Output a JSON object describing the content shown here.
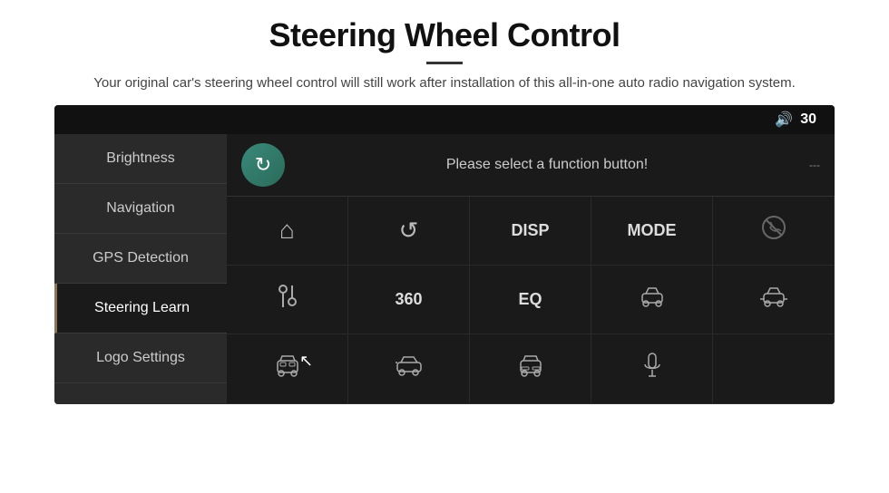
{
  "header": {
    "title": "Steering Wheel Control",
    "description": "Your original car's steering wheel control will still work after installation of this all-in-one auto radio navigation system."
  },
  "device": {
    "volume_icon": "🔊",
    "volume_level": "30",
    "sidebar": {
      "items": [
        {
          "id": "brightness",
          "label": "Brightness",
          "active": false
        },
        {
          "id": "navigation",
          "label": "Navigation",
          "active": false
        },
        {
          "id": "gps-detection",
          "label": "GPS Detection",
          "active": false
        },
        {
          "id": "steering-learn",
          "label": "Steering Learn",
          "active": true
        },
        {
          "id": "logo-settings",
          "label": "Logo Settings",
          "active": false
        }
      ]
    },
    "function_area": {
      "prompt": "Please select a function button!",
      "grid": [
        {
          "id": "home",
          "type": "icon",
          "icon": "⌂",
          "label": "Home"
        },
        {
          "id": "back",
          "type": "icon",
          "icon": "↺",
          "label": "Back"
        },
        {
          "id": "disp",
          "type": "text",
          "text": "DISP",
          "label": "Display"
        },
        {
          "id": "mode",
          "type": "text",
          "text": "MODE",
          "label": "Mode"
        },
        {
          "id": "phone-mute",
          "type": "icon",
          "icon": "🚫",
          "label": "Mute Phone"
        },
        {
          "id": "tune",
          "type": "icon",
          "icon": "⦿⦿",
          "label": "Tune"
        },
        {
          "id": "360",
          "type": "text",
          "text": "360",
          "label": "360"
        },
        {
          "id": "eq",
          "type": "text",
          "text": "EQ",
          "label": "EQ"
        },
        {
          "id": "car1",
          "type": "icon",
          "icon": "🚗",
          "label": "Car 1"
        },
        {
          "id": "car2",
          "type": "icon",
          "icon": "🚗",
          "label": "Car 2"
        },
        {
          "id": "car-front",
          "type": "icon",
          "icon": "🚙",
          "label": "Car Front"
        },
        {
          "id": "car-side",
          "type": "icon",
          "icon": "🚗",
          "label": "Car Side"
        },
        {
          "id": "car-back",
          "type": "icon",
          "icon": "🚙",
          "label": "Car Back"
        },
        {
          "id": "mic",
          "type": "icon",
          "icon": "🎤",
          "label": "Microphone"
        },
        {
          "id": "empty",
          "type": "empty",
          "label": ""
        }
      ]
    }
  }
}
